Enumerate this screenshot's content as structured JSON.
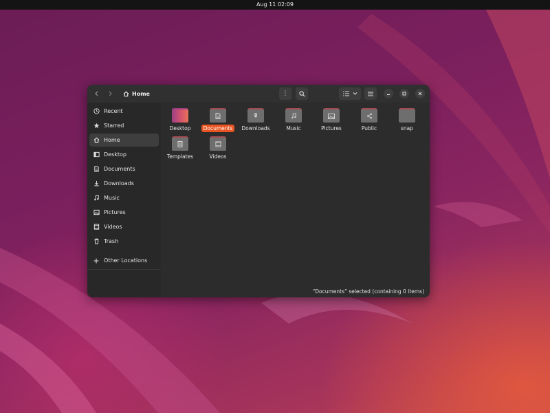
{
  "topbar": {
    "clock": "Aug 11  02:09"
  },
  "headerbar": {
    "path_label": "Home",
    "icons": {
      "back": "chevron-left-icon",
      "forward": "chevron-right-icon",
      "home": "home-icon",
      "more": "vertical-dots-icon",
      "search": "search-icon",
      "list_view": "list-view-icon",
      "view_options": "chevron-down-icon",
      "menu": "hamburger-menu-icon",
      "minimize": "minimize-icon",
      "maximize": "maximize-icon",
      "close": "close-icon"
    }
  },
  "sidebar": {
    "items": [
      {
        "label": "Recent",
        "icon": "clock-icon"
      },
      {
        "label": "Starred",
        "icon": "star-icon"
      },
      {
        "label": "Home",
        "icon": "home-icon",
        "active": true
      },
      {
        "label": "Desktop",
        "icon": "desktop-icon"
      },
      {
        "label": "Documents",
        "icon": "document-icon"
      },
      {
        "label": "Downloads",
        "icon": "download-icon"
      },
      {
        "label": "Music",
        "icon": "music-note-icon"
      },
      {
        "label": "Pictures",
        "icon": "picture-icon"
      },
      {
        "label": "Videos",
        "icon": "video-icon"
      },
      {
        "label": "Trash",
        "icon": "trash-icon"
      }
    ],
    "other_locations": {
      "label": "Other Locations",
      "icon": "plus-icon"
    }
  },
  "files": [
    {
      "name": "Desktop",
      "icon": "desktop-folder-icon"
    },
    {
      "name": "Documents",
      "icon": "documents-folder-icon",
      "selected": true
    },
    {
      "name": "Downloads",
      "icon": "downloads-folder-icon"
    },
    {
      "name": "Music",
      "icon": "music-folder-icon"
    },
    {
      "name": "Pictures",
      "icon": "pictures-folder-icon"
    },
    {
      "name": "Public",
      "icon": "public-folder-icon"
    },
    {
      "name": "snap",
      "icon": "folder-icon"
    },
    {
      "name": "Templates",
      "icon": "templates-folder-icon"
    },
    {
      "name": "Videos",
      "icon": "videos-folder-icon"
    }
  ],
  "status": {
    "text": "“Documents” selected  (containing 0 items)"
  },
  "colors": {
    "accent": "#e95420",
    "folder_tab": "#a44c52",
    "folder_body": "#6e6e6e",
    "window_bg": "#2c2c2c",
    "sidebar_bg": "#282828"
  }
}
